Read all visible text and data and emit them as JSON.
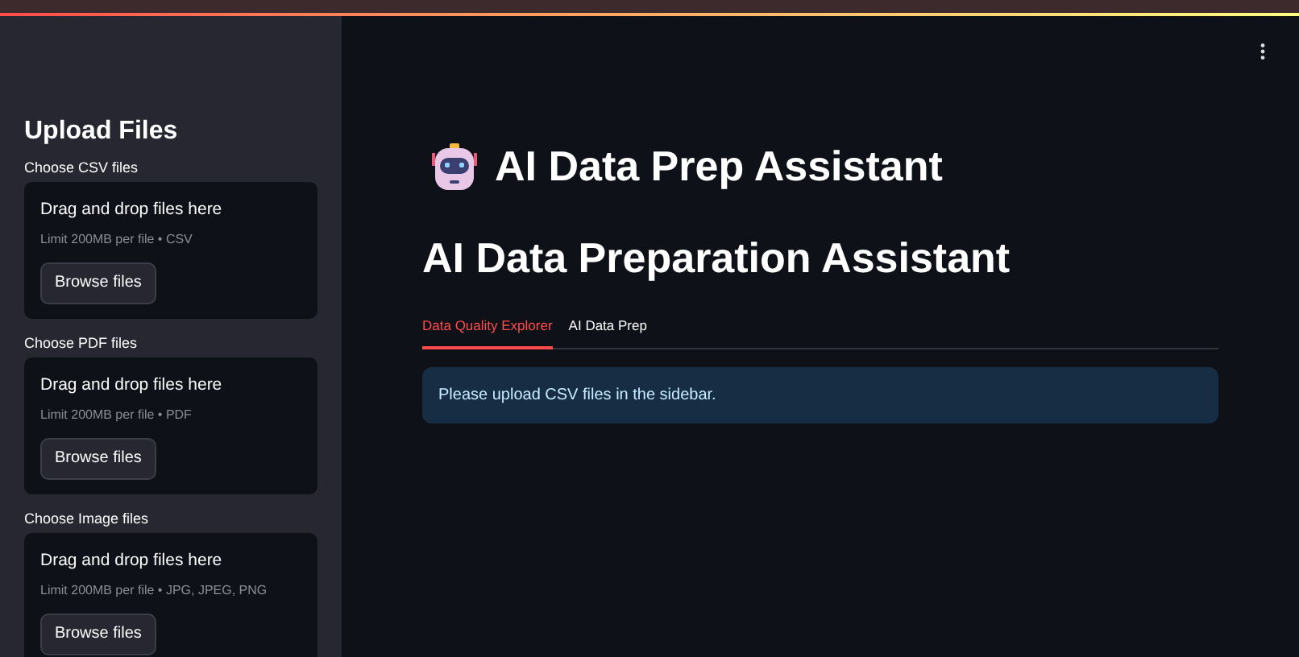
{
  "sidebar": {
    "title": "Upload Files",
    "uploaders": [
      {
        "label": "Choose CSV files",
        "drop_text": "Drag and drop files here",
        "limit": "Limit 200MB per file • CSV",
        "button": "Browse files"
      },
      {
        "label": "Choose PDF files",
        "drop_text": "Drag and drop files here",
        "limit": "Limit 200MB per file • PDF",
        "button": "Browse files"
      },
      {
        "label": "Choose Image files",
        "drop_text": "Drag and drop files here",
        "limit": "Limit 200MB per file • JPG, JPEG, PNG",
        "button": "Browse files"
      }
    ]
  },
  "main": {
    "title": "AI Data Prep Assistant",
    "heading": "AI Data Preparation Assistant",
    "tabs": [
      {
        "label": "Data Quality Explorer",
        "selected": true
      },
      {
        "label": "AI Data Prep",
        "selected": false
      }
    ],
    "info_message": "Please upload CSV files in the sidebar."
  }
}
